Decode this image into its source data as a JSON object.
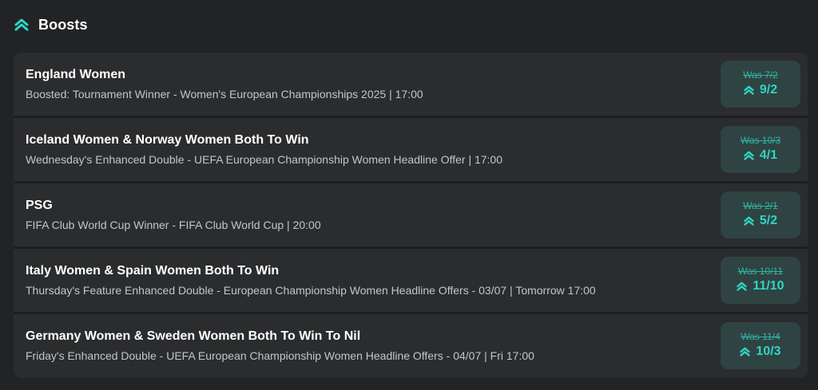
{
  "header": {
    "title": "Boosts",
    "icon": "double-chevron-up-icon",
    "accent_color": "#2fd5c3"
  },
  "boosts": [
    {
      "name": "England Women",
      "description": "Boosted: Tournament Winner - Women's European Championships 2025 | 17:00",
      "was": "Was 7/2",
      "price": "9/2"
    },
    {
      "name": "Iceland Women & Norway Women Both To Win",
      "description": "Wednesday's Enhanced Double - UEFA European Championship Women Headline Offer | 17:00",
      "was": "Was 10/3",
      "price": "4/1"
    },
    {
      "name": "PSG",
      "description": "FIFA Club World Cup Winner - FIFA Club World Cup | 20:00",
      "was": "Was 2/1",
      "price": "5/2"
    },
    {
      "name": "Italy Women & Spain Women Both To Win",
      "description": "Thursday's Feature Enhanced Double - European Championship Women Headline Offers - 03/07 | Tomorrow 17:00",
      "was": "Was 10/11",
      "price": "11/10"
    },
    {
      "name": "Germany Women & Sweden Women Both To Win To Nil",
      "description": "Friday's Enhanced Double - UEFA European Championship Women Headline Offers - 04/07 | Fri 17:00",
      "was": "Was 11/4",
      "price": "10/3"
    }
  ]
}
